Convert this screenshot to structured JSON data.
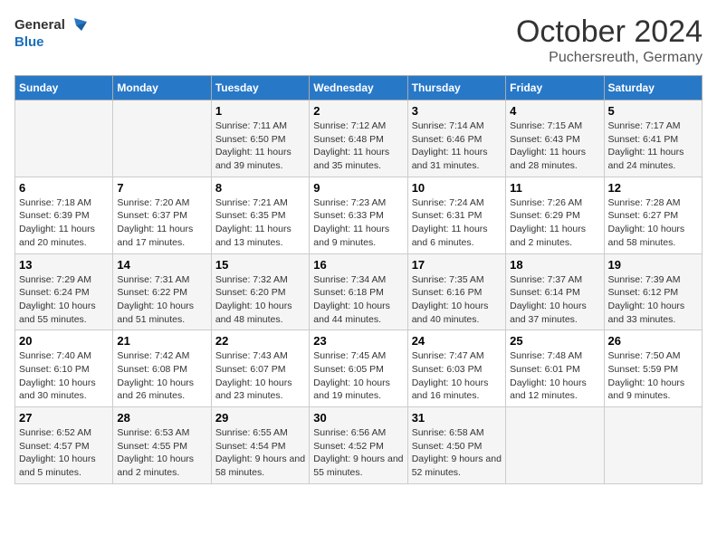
{
  "header": {
    "logo_general": "General",
    "logo_blue": "Blue",
    "title": "October 2024",
    "subtitle": "Puchersreuth, Germany"
  },
  "days_of_week": [
    "Sunday",
    "Monday",
    "Tuesday",
    "Wednesday",
    "Thursday",
    "Friday",
    "Saturday"
  ],
  "weeks": [
    [
      {
        "day": "",
        "info": ""
      },
      {
        "day": "",
        "info": ""
      },
      {
        "day": "1",
        "info": "Sunrise: 7:11 AM\nSunset: 6:50 PM\nDaylight: 11 hours and 39 minutes."
      },
      {
        "day": "2",
        "info": "Sunrise: 7:12 AM\nSunset: 6:48 PM\nDaylight: 11 hours and 35 minutes."
      },
      {
        "day": "3",
        "info": "Sunrise: 7:14 AM\nSunset: 6:46 PM\nDaylight: 11 hours and 31 minutes."
      },
      {
        "day": "4",
        "info": "Sunrise: 7:15 AM\nSunset: 6:43 PM\nDaylight: 11 hours and 28 minutes."
      },
      {
        "day": "5",
        "info": "Sunrise: 7:17 AM\nSunset: 6:41 PM\nDaylight: 11 hours and 24 minutes."
      }
    ],
    [
      {
        "day": "6",
        "info": "Sunrise: 7:18 AM\nSunset: 6:39 PM\nDaylight: 11 hours and 20 minutes."
      },
      {
        "day": "7",
        "info": "Sunrise: 7:20 AM\nSunset: 6:37 PM\nDaylight: 11 hours and 17 minutes."
      },
      {
        "day": "8",
        "info": "Sunrise: 7:21 AM\nSunset: 6:35 PM\nDaylight: 11 hours and 13 minutes."
      },
      {
        "day": "9",
        "info": "Sunrise: 7:23 AM\nSunset: 6:33 PM\nDaylight: 11 hours and 9 minutes."
      },
      {
        "day": "10",
        "info": "Sunrise: 7:24 AM\nSunset: 6:31 PM\nDaylight: 11 hours and 6 minutes."
      },
      {
        "day": "11",
        "info": "Sunrise: 7:26 AM\nSunset: 6:29 PM\nDaylight: 11 hours and 2 minutes."
      },
      {
        "day": "12",
        "info": "Sunrise: 7:28 AM\nSunset: 6:27 PM\nDaylight: 10 hours and 58 minutes."
      }
    ],
    [
      {
        "day": "13",
        "info": "Sunrise: 7:29 AM\nSunset: 6:24 PM\nDaylight: 10 hours and 55 minutes."
      },
      {
        "day": "14",
        "info": "Sunrise: 7:31 AM\nSunset: 6:22 PM\nDaylight: 10 hours and 51 minutes."
      },
      {
        "day": "15",
        "info": "Sunrise: 7:32 AM\nSunset: 6:20 PM\nDaylight: 10 hours and 48 minutes."
      },
      {
        "day": "16",
        "info": "Sunrise: 7:34 AM\nSunset: 6:18 PM\nDaylight: 10 hours and 44 minutes."
      },
      {
        "day": "17",
        "info": "Sunrise: 7:35 AM\nSunset: 6:16 PM\nDaylight: 10 hours and 40 minutes."
      },
      {
        "day": "18",
        "info": "Sunrise: 7:37 AM\nSunset: 6:14 PM\nDaylight: 10 hours and 37 minutes."
      },
      {
        "day": "19",
        "info": "Sunrise: 7:39 AM\nSunset: 6:12 PM\nDaylight: 10 hours and 33 minutes."
      }
    ],
    [
      {
        "day": "20",
        "info": "Sunrise: 7:40 AM\nSunset: 6:10 PM\nDaylight: 10 hours and 30 minutes."
      },
      {
        "day": "21",
        "info": "Sunrise: 7:42 AM\nSunset: 6:08 PM\nDaylight: 10 hours and 26 minutes."
      },
      {
        "day": "22",
        "info": "Sunrise: 7:43 AM\nSunset: 6:07 PM\nDaylight: 10 hours and 23 minutes."
      },
      {
        "day": "23",
        "info": "Sunrise: 7:45 AM\nSunset: 6:05 PM\nDaylight: 10 hours and 19 minutes."
      },
      {
        "day": "24",
        "info": "Sunrise: 7:47 AM\nSunset: 6:03 PM\nDaylight: 10 hours and 16 minutes."
      },
      {
        "day": "25",
        "info": "Sunrise: 7:48 AM\nSunset: 6:01 PM\nDaylight: 10 hours and 12 minutes."
      },
      {
        "day": "26",
        "info": "Sunrise: 7:50 AM\nSunset: 5:59 PM\nDaylight: 10 hours and 9 minutes."
      }
    ],
    [
      {
        "day": "27",
        "info": "Sunrise: 6:52 AM\nSunset: 4:57 PM\nDaylight: 10 hours and 5 minutes."
      },
      {
        "day": "28",
        "info": "Sunrise: 6:53 AM\nSunset: 4:55 PM\nDaylight: 10 hours and 2 minutes."
      },
      {
        "day": "29",
        "info": "Sunrise: 6:55 AM\nSunset: 4:54 PM\nDaylight: 9 hours and 58 minutes."
      },
      {
        "day": "30",
        "info": "Sunrise: 6:56 AM\nSunset: 4:52 PM\nDaylight: 9 hours and 55 minutes."
      },
      {
        "day": "31",
        "info": "Sunrise: 6:58 AM\nSunset: 4:50 PM\nDaylight: 9 hours and 52 minutes."
      },
      {
        "day": "",
        "info": ""
      },
      {
        "day": "",
        "info": ""
      }
    ]
  ]
}
